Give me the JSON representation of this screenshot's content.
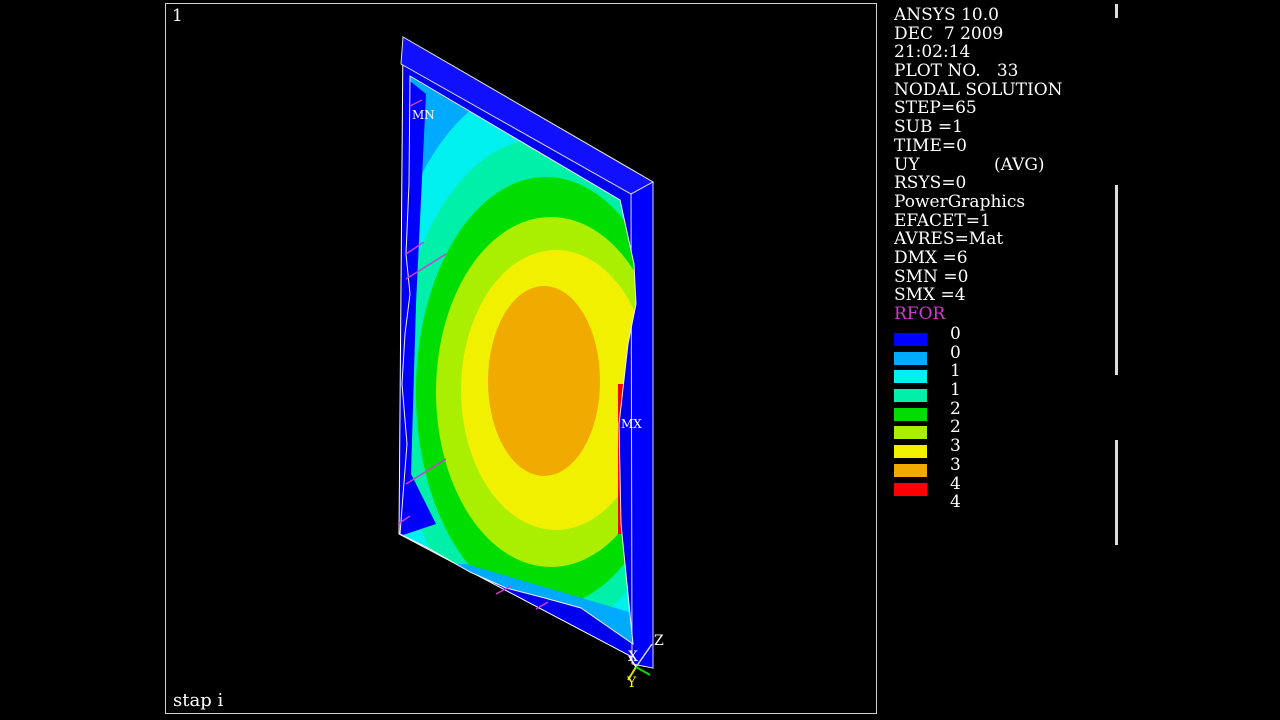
{
  "window": {
    "number": "1",
    "plot_title": "stap i"
  },
  "info": {
    "lines": [
      "ANSYS 10.0",
      "DEC  7 2009",
      "21:02:14",
      "PLOT NO.   33",
      "NODAL SOLUTION",
      "STEP=65",
      "SUB =1",
      "TIME=0"
    ],
    "result_component": "UY",
    "result_avg": "(AVG)",
    "lines2": [
      "RSYS=0",
      "PowerGraphics",
      "EFACET=1",
      "AVRES=Mat",
      "DMX =6",
      "SMN =0",
      "SMX =4"
    ],
    "reaction_label": "RFOR"
  },
  "legend": {
    "labels": [
      "0",
      "0",
      "1",
      "1",
      "2",
      "2",
      "3",
      "3",
      "4",
      "4"
    ],
    "colors": [
      "#0000ff",
      "#00aaff",
      "#00f0f0",
      "#00f0aa",
      "#00dd00",
      "#aaee00",
      "#f0f000",
      "#f0aa00",
      "#ff0000"
    ]
  },
  "model": {
    "min_label": "MN",
    "max_label": "MX",
    "triad": {
      "x": "X",
      "y": "Y",
      "z": "Z"
    }
  }
}
